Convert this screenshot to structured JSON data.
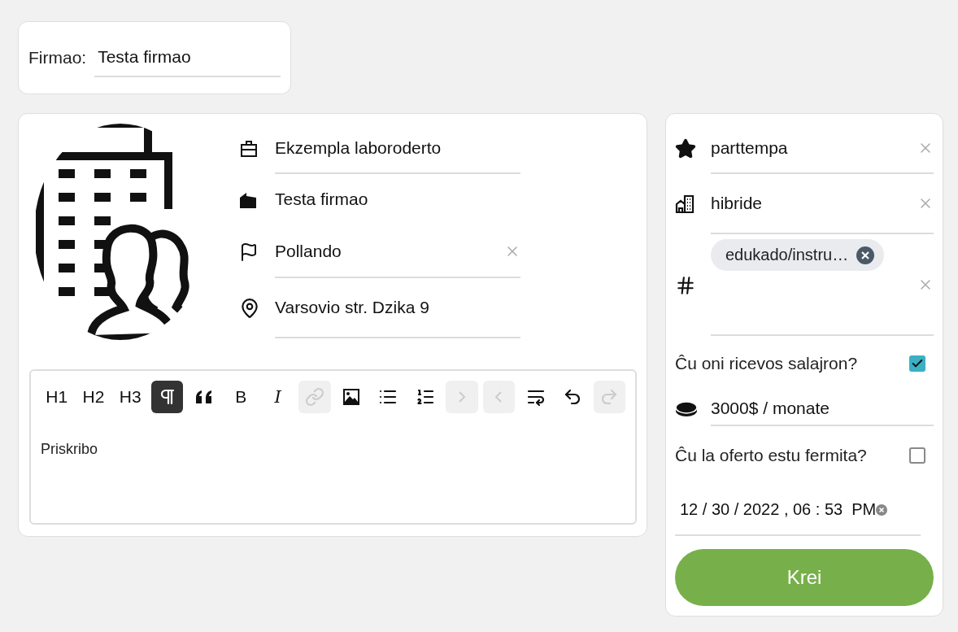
{
  "company_field": {
    "label": "Firmao:",
    "value": "Testa firmao"
  },
  "details": {
    "fields": [
      {
        "kind": "briefcase",
        "value": "Ekzempla laboroderto",
        "clearable": false,
        "underlined": true
      },
      {
        "kind": "factory",
        "value": "Testa firmao",
        "clearable": false,
        "underlined": false
      },
      {
        "kind": "flag",
        "value": "Pollando",
        "clearable": true,
        "underlined": true
      },
      {
        "kind": "pin",
        "value": "Varsovio str. Dzika 9",
        "clearable": false,
        "underlined": true
      }
    ]
  },
  "editor": {
    "toolbar": [
      {
        "kind": "text",
        "label": "H1",
        "active": false,
        "disabled": false
      },
      {
        "kind": "text",
        "label": "H2",
        "active": false,
        "disabled": false
      },
      {
        "kind": "text",
        "label": "H3",
        "active": false,
        "disabled": false
      },
      {
        "kind": "paragraph",
        "active": true,
        "disabled": false
      },
      {
        "kind": "quote",
        "active": false,
        "disabled": false
      },
      {
        "kind": "text",
        "label": "B",
        "active": false,
        "disabled": false
      },
      {
        "kind": "italic",
        "label": "I",
        "active": false,
        "disabled": false
      },
      {
        "kind": "link",
        "active": false,
        "disabled": true
      },
      {
        "kind": "image",
        "active": false,
        "disabled": false
      },
      {
        "kind": "bullet-list",
        "active": false,
        "disabled": false
      },
      {
        "kind": "ordered-list",
        "active": false,
        "disabled": false
      },
      {
        "kind": "indent",
        "active": false,
        "disabled": true
      },
      {
        "kind": "outdent",
        "active": false,
        "disabled": true
      },
      {
        "kind": "wrap",
        "active": false,
        "disabled": false
      },
      {
        "kind": "undo",
        "active": false,
        "disabled": false
      },
      {
        "kind": "redo",
        "active": false,
        "disabled": true
      }
    ],
    "placeholder": "Priskribo"
  },
  "side": {
    "fields": [
      {
        "kind": "star",
        "value": "parttempa",
        "clearable": true
      },
      {
        "kind": "building",
        "value": "hibride",
        "clearable": true
      },
      {
        "kind": "hash",
        "tags": [
          "edukado/instru…"
        ],
        "clearable": true
      }
    ],
    "salary_toggle": {
      "label": "Ĉu oni ricevos salajron?",
      "checked": true
    },
    "salary": {
      "kind": "coins",
      "value": "3000$ / monate"
    },
    "closed_toggle": {
      "label": "Ĉu la oferto estu fermita?",
      "checked": false
    },
    "deadline": {
      "value": "12 / 30 / 2022 , 06 : 53  PM"
    },
    "submit": "Krei"
  }
}
